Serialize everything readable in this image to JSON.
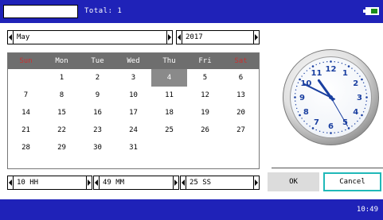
{
  "top_bar": {
    "input_value": "",
    "total_label": "Total: 1",
    "battery_color": "#1a8c1a"
  },
  "month_field": {
    "value": "May"
  },
  "year_field": {
    "value": "2017"
  },
  "calendar": {
    "weekdays": [
      "Sun",
      "Mon",
      "Tue",
      "Wed",
      "Thu",
      "Fri",
      "Sat"
    ],
    "weeks": [
      [
        "",
        "1",
        "2",
        "3",
        "4",
        "5",
        "6"
      ],
      [
        "7",
        "8",
        "9",
        "10",
        "11",
        "12",
        "13"
      ],
      [
        "14",
        "15",
        "16",
        "17",
        "18",
        "19",
        "20"
      ],
      [
        "21",
        "22",
        "23",
        "24",
        "25",
        "26",
        "27"
      ],
      [
        "28",
        "29",
        "30",
        "31",
        "",
        "",
        ""
      ]
    ],
    "selected_day": "4",
    "weekend_color": "#c83232",
    "header_color": "#6e6e6e"
  },
  "clock": {
    "numerals": [
      "12",
      "1",
      "2",
      "3",
      "4",
      "5",
      "6",
      "7",
      "8",
      "9",
      "10",
      "11"
    ],
    "hour": 10,
    "minute": 49,
    "second": 25,
    "hand_color": "#1a3fa0",
    "numeral_color": "#1a3fa0"
  },
  "time_fields": {
    "hours": "10 HH",
    "minutes": "49 MM",
    "seconds": "25 SS"
  },
  "buttons": {
    "ok_label": "OK",
    "cancel_label": "Cancel"
  },
  "bottom_bar": {
    "time": "10:49"
  },
  "colors": {
    "bar_blue": "#1f22b8",
    "focus_border": "#20b8b8"
  }
}
